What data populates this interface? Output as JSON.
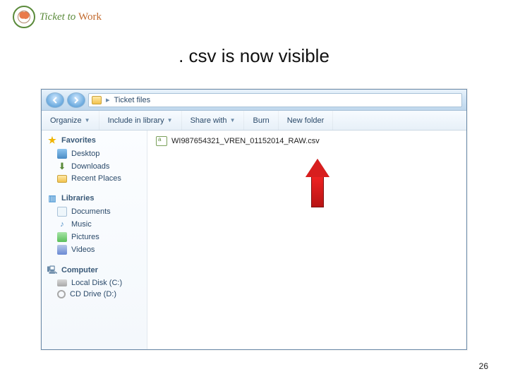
{
  "logo": {
    "brand_left": "Ticket",
    "brand_mid": " to ",
    "brand_right": "Work"
  },
  "slide": {
    "title": ". csv is now visible",
    "page_number": "26"
  },
  "explorer": {
    "breadcrumb": "Ticket files",
    "toolbar": {
      "organize": "Organize",
      "include": "Include in library",
      "share": "Share with",
      "burn": "Burn",
      "newfolder": "New folder"
    },
    "nav": {
      "favorites": {
        "label": "Favorites",
        "items": [
          {
            "key": "desktop",
            "label": "Desktop"
          },
          {
            "key": "downloads",
            "label": "Downloads"
          },
          {
            "key": "recent",
            "label": "Recent Places"
          }
        ]
      },
      "libraries": {
        "label": "Libraries",
        "items": [
          {
            "key": "documents",
            "label": "Documents"
          },
          {
            "key": "music",
            "label": "Music"
          },
          {
            "key": "pictures",
            "label": "Pictures"
          },
          {
            "key": "videos",
            "label": "Videos"
          }
        ]
      },
      "computer": {
        "label": "Computer",
        "items": [
          {
            "key": "localdisk",
            "label": "Local Disk (C:)"
          },
          {
            "key": "cddrive",
            "label": "CD Drive (D:)"
          }
        ]
      }
    },
    "file": {
      "name": "WI987654321_VREN_01152014_RAW.csv"
    }
  }
}
